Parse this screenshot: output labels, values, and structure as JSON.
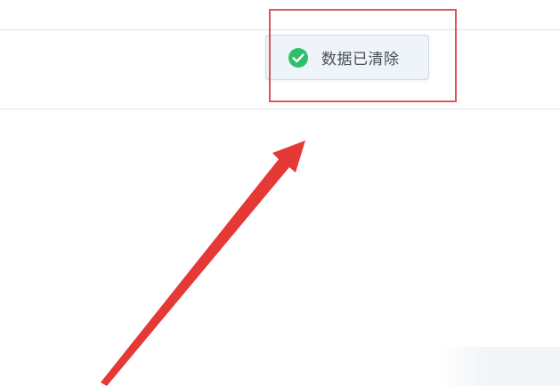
{
  "toast": {
    "message": "数据已清除",
    "icon": "check-circle-icon",
    "icon_color": "#2ebf6a",
    "background": "#eef4fa"
  },
  "annotation": {
    "highlight_color": "#d9575c",
    "arrow_color": "#e53935"
  }
}
